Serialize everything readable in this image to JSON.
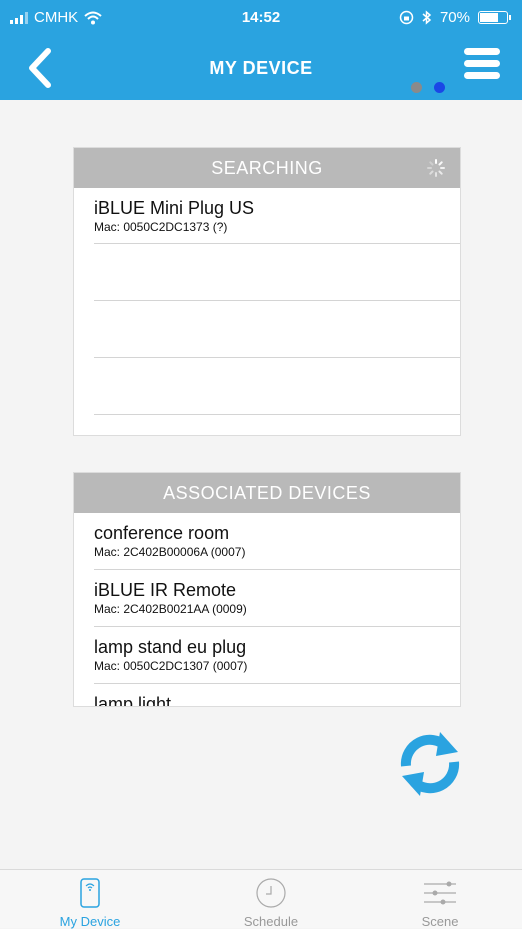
{
  "status_bar": {
    "carrier": "CMHK",
    "time": "14:52",
    "battery_percent": "70%",
    "battery_level": 0.7
  },
  "header": {
    "title": "MY DEVICE",
    "back_icon": "chevron-left-icon",
    "menu_icon": "hamburger-menu-icon",
    "page_indicator": {
      "count": 2,
      "active_index": 1
    }
  },
  "searching_panel": {
    "title": "SEARCHING",
    "devices": [
      {
        "name": "iBLUE Mini Plug US",
        "mac": "Mac: 0050C2DC1373 (?)"
      }
    ],
    "empty_rows": 3
  },
  "associated_panel": {
    "title": "ASSOCIATED DEVICES",
    "devices": [
      {
        "name": "conference room",
        "mac": "Mac: 2C402B00006A (0007)"
      },
      {
        "name": "iBLUE IR Remote",
        "mac": "Mac: 2C402B0021AA (0009)"
      },
      {
        "name": "lamp stand eu plug",
        "mac": "Mac: 0050C2DC1307 (0007)"
      },
      {
        "name": "lamp light",
        "mac": ""
      }
    ]
  },
  "refresh_icon": "refresh-icon",
  "tabs": [
    {
      "label": "My Device",
      "icon": "phone-wifi-icon",
      "active": true
    },
    {
      "label": "Schedule",
      "icon": "clock-icon",
      "active": false
    },
    {
      "label": "Scene",
      "icon": "sliders-icon",
      "active": false
    }
  ],
  "colors": {
    "accent": "#2aa3e0",
    "header_gray": "#b9b9b9",
    "tab_active": "#2aa3e0",
    "tab_inactive": "#999999",
    "dot_active": "#1a47e6",
    "dot_inactive": "#8a8a8a"
  }
}
